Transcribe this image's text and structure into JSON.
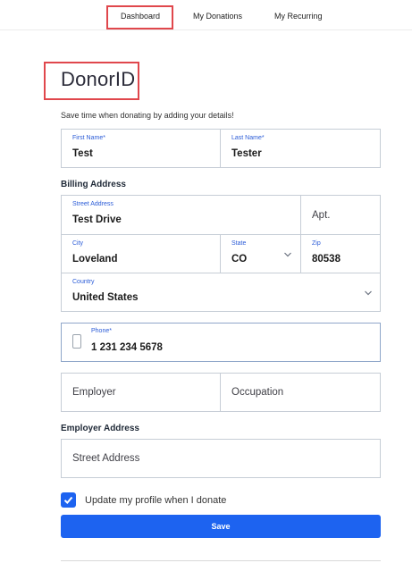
{
  "nav": {
    "tabs": [
      {
        "label": "Dashboard"
      },
      {
        "label": "My Donations"
      },
      {
        "label": "My Recurring"
      }
    ]
  },
  "page": {
    "title": "DonorID",
    "subtitle": "Save time when donating by adding your details!"
  },
  "name": {
    "first": {
      "label": "First Name*",
      "value": "Test"
    },
    "last": {
      "label": "Last Name*",
      "value": "Tester"
    }
  },
  "billing": {
    "heading": "Billing Address",
    "street": {
      "label": "Street Address",
      "value": "Test Drive"
    },
    "apt": {
      "placeholder": "Apt."
    },
    "city": {
      "label": "City",
      "value": "Loveland"
    },
    "state": {
      "label": "State",
      "value": "CO"
    },
    "zip": {
      "label": "Zip",
      "value": "80538"
    },
    "country": {
      "label": "Country",
      "value": "United States"
    }
  },
  "phone": {
    "label": "Phone*",
    "value": "1 231 234 5678"
  },
  "employment": {
    "employer_placeholder": "Employer",
    "occupation_placeholder": "Occupation"
  },
  "employer_address": {
    "heading": "Employer Address",
    "street_placeholder": "Street Address"
  },
  "profile": {
    "update_label": "Update my profile when I donate",
    "checked": true
  },
  "actions": {
    "save_label": "Save"
  },
  "colors": {
    "accent": "#1d63f0",
    "label_blue": "#2a5bd7",
    "highlight": "#e0474c"
  }
}
